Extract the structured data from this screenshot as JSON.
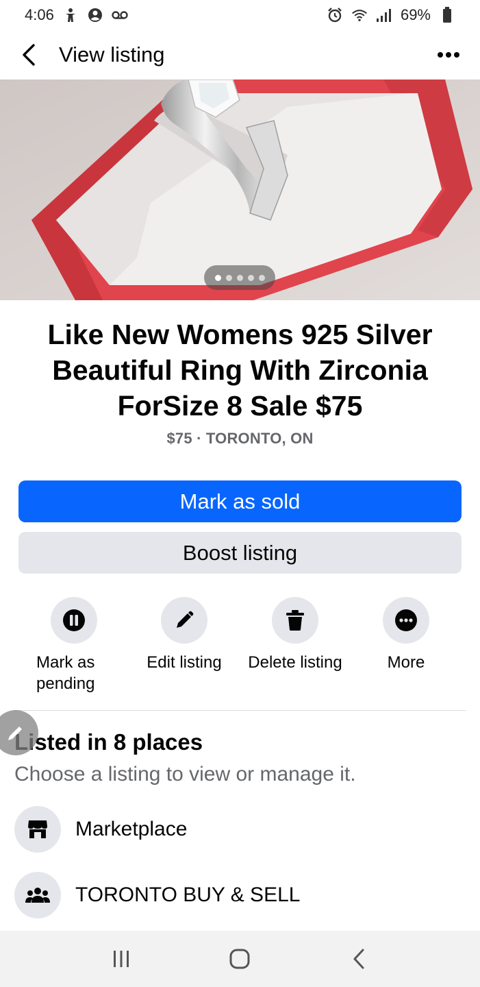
{
  "status_bar": {
    "time": "4:06",
    "battery": "69%",
    "icons_left": [
      "accessibility-icon",
      "account-circle-icon",
      "voicemail-icon"
    ],
    "icons_right": [
      "alarm-icon",
      "wifi-icon",
      "signal-icon",
      "battery-icon"
    ]
  },
  "header": {
    "title": "View listing",
    "back_icon": "chevron-left-icon",
    "more_icon": "more-horizontal-icon"
  },
  "photo": {
    "description_icon": "ring-photo",
    "pager_total": 5,
    "pager_active": 1
  },
  "listing": {
    "title": "Like New Womens 925 Silver Beautiful Ring With Zirconia ForSize 8  Sale $75",
    "meta": "$75 · TORONTO, ON"
  },
  "buttons": {
    "primary": "Mark as sold",
    "secondary": "Boost listing"
  },
  "actions": [
    {
      "label": "Mark as pending",
      "icon": "pause-icon"
    },
    {
      "label": "Edit listing",
      "icon": "pencil-icon"
    },
    {
      "label": "Delete listing",
      "icon": "trash-icon"
    },
    {
      "label": "More",
      "icon": "more-icon"
    }
  ],
  "listed": {
    "title": "Listed in 8 places",
    "subtitle": "Choose a listing to view or manage it.",
    "places": [
      {
        "label": "Marketplace",
        "icon": "store-icon"
      },
      {
        "label": "TORONTO BUY & SELL",
        "icon": "group-icon"
      }
    ]
  },
  "nav_bar": {
    "buttons": [
      "recents-icon",
      "home-icon",
      "back-icon"
    ]
  },
  "colors": {
    "primary": "#0866ff",
    "secondary_bg": "#e4e6eb",
    "muted_text": "#65676b"
  }
}
